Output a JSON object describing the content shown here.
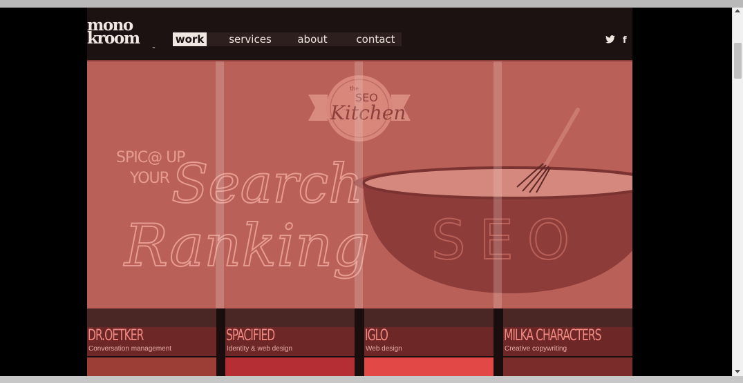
{
  "logo": {
    "line1": "mono",
    "line2": "kroom",
    "tm": "™"
  },
  "nav": [
    {
      "label": "work",
      "active": true
    },
    {
      "label": "services",
      "active": false
    },
    {
      "label": "about",
      "active": false
    },
    {
      "label": "contact",
      "active": false
    }
  ],
  "social": {
    "twitter": "twitter-icon",
    "facebook": "facebook-icon",
    "facebook_glyph": "f"
  },
  "hero": {
    "badge_top": "the",
    "badge_seo": "SEO",
    "badge_script": "Kitchen",
    "tagline_1": "SPIC@ UP",
    "tagline_2": "YOUR",
    "script_1": "Search",
    "script_2": "Ranking",
    "bowl_text": "SEO"
  },
  "projects": [
    {
      "title": "DR.OETKER",
      "subtitle": "Conversation management",
      "thumb_color": "#9c3d36"
    },
    {
      "title": "SPACIFIED",
      "subtitle": "Identity & web design",
      "thumb_color": "#b52e33"
    },
    {
      "title": "IGLO",
      "subtitle": "Web design",
      "thumb_color": "#e24845"
    },
    {
      "title": "MILKA CHARACTERS",
      "subtitle": "Creative copywriting",
      "thumb_color": "#7a2c2a"
    }
  ],
  "colors": {
    "hero_bg": "#b96058",
    "accent_text": "#f08a82",
    "nav_active_bg": "#f0e7e2"
  }
}
